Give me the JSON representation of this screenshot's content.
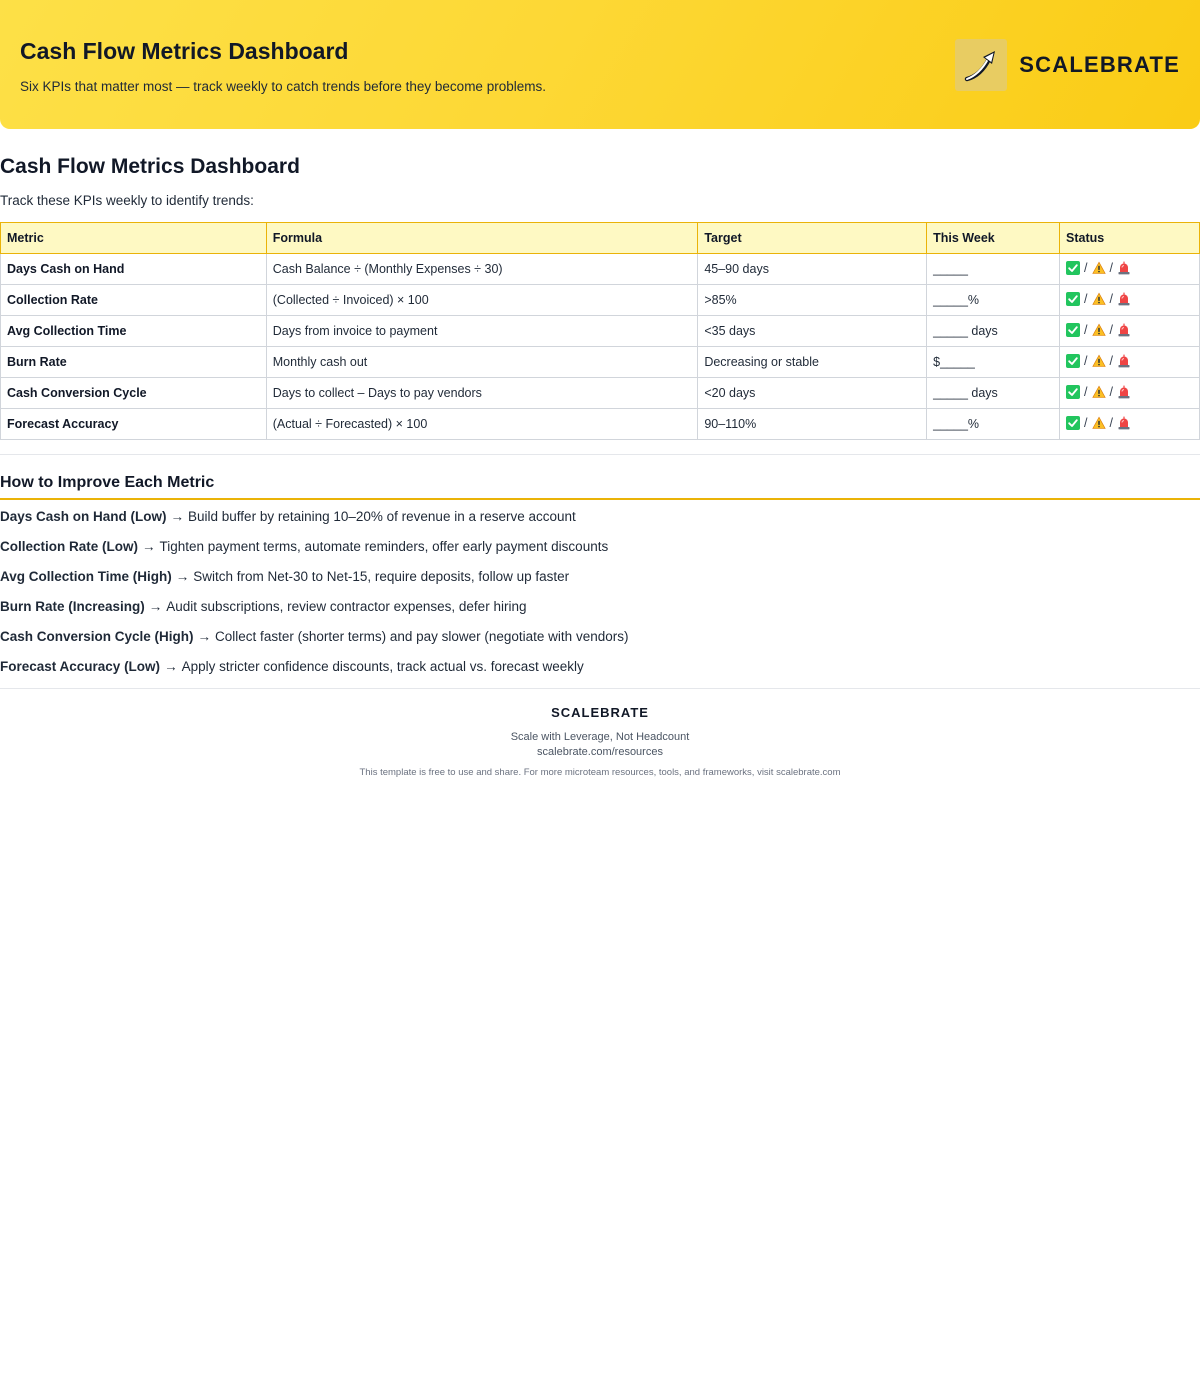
{
  "header": {
    "title": "Cash Flow Metrics Dashboard",
    "subtitle": "Six KPIs that matter most — track weekly to catch trends before they become problems.",
    "brand_name": "SCALEBRATE",
    "brand_logo_icon": "growth-arrow-icon"
  },
  "main": {
    "title": "Cash Flow Metrics Dashboard",
    "intro": "Track these KPIs weekly to identify trends:"
  },
  "table": {
    "headers": [
      "Metric",
      "Formula",
      "Target",
      "This Week",
      "Status"
    ],
    "rows": [
      [
        "Days Cash on Hand",
        "Cash Balance ÷ (Monthly Expenses ÷ 30)",
        "45–90 days",
        "_____"
      ],
      [
        "Collection Rate",
        "(Collected ÷ Invoiced) × 100",
        ">85%",
        "_____%"
      ],
      [
        "Avg Collection Time",
        "Days from invoice to payment",
        "<35 days",
        "_____ days"
      ],
      [
        "Burn Rate",
        "Monthly cash out",
        "Decreasing or stable",
        "$_____"
      ],
      [
        "Cash Conversion Cycle",
        "Days to collect – Days to pay vendors",
        "<20 days",
        "_____ days"
      ],
      [
        "Forecast Accuracy",
        "(Actual ÷ Forecasted) × 100",
        "90–110%",
        "_____%"
      ]
    ],
    "status_icons": [
      "check-mark-icon",
      "warning-icon",
      "siren-icon"
    ],
    "status_separator": "/"
  },
  "improve": {
    "title": "How to Improve Each Metric",
    "arrow": "→",
    "items": [
      {
        "label": "Days Cash on Hand (Low)",
        "text": "Build buffer by retaining 10–20% of revenue in a reserve account"
      },
      {
        "label": "Collection Rate (Low)",
        "text": "Tighten payment terms, automate reminders, offer early payment discounts"
      },
      {
        "label": "Avg Collection Time (High)",
        "text": "Switch from Net-30 to Net-15, require deposits, follow up faster"
      },
      {
        "label": "Burn Rate (Increasing)",
        "text": "Audit subscriptions, review contractor expenses, defer hiring"
      },
      {
        "label": "Cash Conversion Cycle (High)",
        "text": "Collect faster (shorter terms) and pay slower (negotiate with vendors)"
      },
      {
        "label": "Forecast Accuracy (Low)",
        "text": "Apply stricter confidence discounts, track actual vs. forecast weekly"
      }
    ]
  },
  "footer": {
    "brand": "SCALEBRATE",
    "tagline": "Scale with Leverage, Not Headcount",
    "url": "scalebrate.com/resources",
    "note": "This template is free to use and share. For more microteam resources, tools, and frameworks, visit scalebrate.com"
  },
  "colors": {
    "accent": "#eab308",
    "banner_start": "#fde047",
    "banner_end": "#facc15",
    "header_row": "#fef9c3",
    "ok": "#22c55e"
  }
}
